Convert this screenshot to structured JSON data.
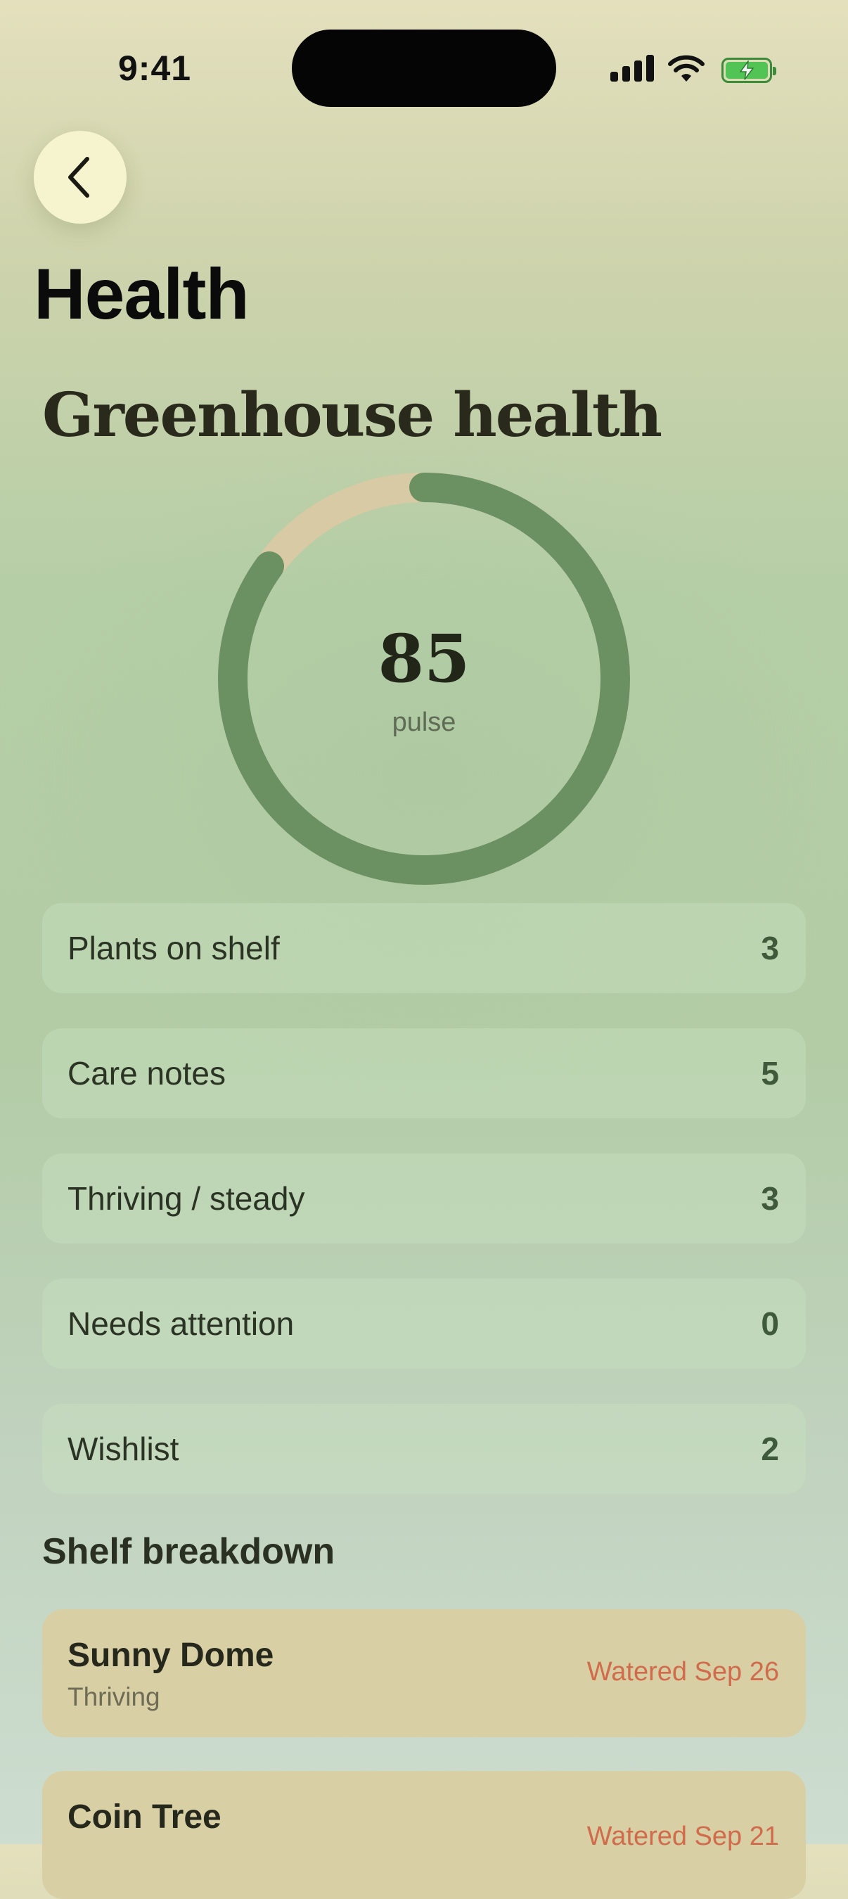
{
  "status_bar": {
    "time": "9:41"
  },
  "header": {
    "back_icon": "chevron-left-icon",
    "title": "Health"
  },
  "section": {
    "title": "Greenhouse health"
  },
  "gauge": {
    "value": "85",
    "label": "pulse",
    "fraction": 0.85,
    "track_color": "#d7caa4",
    "fill_color": "#6b9163"
  },
  "stats": [
    {
      "label": "Plants on shelf",
      "value": "3"
    },
    {
      "label": "Care notes",
      "value": "5"
    },
    {
      "label": "Thriving / steady",
      "value": "3"
    },
    {
      "label": "Needs attention",
      "value": "0"
    },
    {
      "label": "Wishlist",
      "value": "2"
    }
  ],
  "breakdown": {
    "heading": "Shelf breakdown",
    "items": [
      {
        "name": "Sunny Dome",
        "status": "Thriving",
        "watered": "Watered Sep 26"
      },
      {
        "name": "Coin Tree",
        "status": "",
        "watered": "Watered Sep 21"
      }
    ]
  }
}
